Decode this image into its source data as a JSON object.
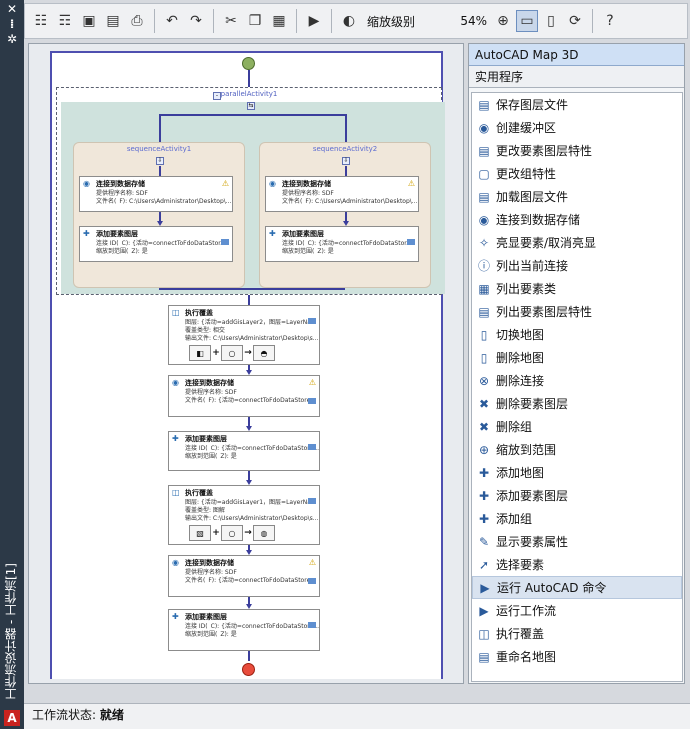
{
  "sidebar": {
    "close_glyph": "✕",
    "pin_glyph": "⁞",
    "gear_glyph": "✲",
    "title": "工作流设计器 - 工作流[1]"
  },
  "toolbar": {
    "zoom_label": "缩放级别",
    "zoom_value": "54%"
  },
  "workflow": {
    "parallel_label": "parallelActivity1",
    "sequences": [
      {
        "label": "sequenceActivity1",
        "activities": [
          {
            "title": "连接到数据存储",
            "lines": [
              "提供程序名称: SDF",
              "文件名(_F): C:\\Users\\Administrator\\Desktop\\..."
            ]
          },
          {
            "title": "添加要素图层",
            "lines": [
              "连接 ID(_C): {活动=connectToFdoDataStor...",
              "缩放到范围(_Z): 是"
            ]
          }
        ]
      },
      {
        "label": "sequenceActivity2",
        "activities": [
          {
            "title": "连接到数据存储",
            "lines": [
              "提供程序名称: SDF",
              "文件名(_F): C:\\Users\\Administrator\\Desktop\\..."
            ]
          },
          {
            "title": "添加要素图层",
            "lines": [
              "连接 ID(_C): {活动=connectToFdoDataStor...",
              "缩放到范围(_Z): 是"
            ]
          }
        ]
      }
    ],
    "main": [
      {
        "title": "执行覆盖",
        "lines": [
          "图层: {活动=addGisLayer2，图层=LayerNa...",
          "覆盖类型: 相交",
          "输出文件: C:\\Users\\Administrator\\Desktop\\s..."
        ],
        "overlay": true
      },
      {
        "title": "连接到数据存储",
        "lines": [
          "提供程序名称: SDF",
          "文件名(_F): {活动=connectToFdoDataStore..."
        ]
      },
      {
        "title": "添加要素图层",
        "lines": [
          "连接 ID(_C): {活动=connectToFdoDataStore...",
          "缩放到范围(_Z): 是"
        ]
      },
      {
        "title": "执行覆盖",
        "lines": [
          "图层: {活动=addGisLayer1，图层=LayerNa...",
          "覆盖类型: 图解",
          "输出文件: C:\\Users\\Administrator\\Desktop\\s..."
        ],
        "overlay": true
      },
      {
        "title": "连接到数据存储",
        "lines": [
          "提供程序名称: SDF",
          "文件名(_F): {活动=connectToFdoDataStore..."
        ]
      },
      {
        "title": "添加要素图层",
        "lines": [
          "连接 ID(_C): {活动=connectToFdoDataStore...",
          "缩放到范围(_Z): 是"
        ]
      }
    ]
  },
  "right_panel": {
    "header": "AutoCAD Map 3D",
    "subheader": "实用程序",
    "items": [
      {
        "label": "保存图层文件",
        "icon": "save-layer-icon"
      },
      {
        "label": "创建缓冲区",
        "icon": "buffer-icon"
      },
      {
        "label": "更改要素图层特性",
        "icon": "layer-props-icon"
      },
      {
        "label": "更改组特性",
        "icon": "group-props-icon"
      },
      {
        "label": "加载图层文件",
        "icon": "load-layer-icon"
      },
      {
        "label": "连接到数据存储",
        "icon": "connect-icon"
      },
      {
        "label": "亮显要素/取消亮显",
        "icon": "highlight-icon"
      },
      {
        "label": "列出当前连接",
        "icon": "list-connections-icon"
      },
      {
        "label": "列出要素类",
        "icon": "list-classes-icon"
      },
      {
        "label": "列出要素图层特性",
        "icon": "list-layer-props-icon"
      },
      {
        "label": "切换地图",
        "icon": "switch-map-icon"
      },
      {
        "label": "删除地图",
        "icon": "delete-map-icon"
      },
      {
        "label": "删除连接",
        "icon": "delete-connection-icon"
      },
      {
        "label": "删除要素图层",
        "icon": "delete-layer-icon"
      },
      {
        "label": "删除组",
        "icon": "delete-group-icon"
      },
      {
        "label": "缩放到范围",
        "icon": "zoom-extents-icon"
      },
      {
        "label": "添加地图",
        "icon": "add-map-icon"
      },
      {
        "label": "添加要素图层",
        "icon": "add-layer-icon"
      },
      {
        "label": "添加组",
        "icon": "add-group-icon"
      },
      {
        "label": "显示要素属性",
        "icon": "show-attributes-icon"
      },
      {
        "label": "选择要素",
        "icon": "select-icon"
      },
      {
        "label": "运行 AutoCAD 命令",
        "icon": "run-command-icon",
        "selected": true
      },
      {
        "label": "运行工作流",
        "icon": "run-workflow-icon"
      },
      {
        "label": "执行覆盖",
        "icon": "overlay-icon"
      },
      {
        "label": "重命名地图",
        "icon": "rename-map-icon"
      }
    ]
  },
  "status": {
    "label": "工作流状态:",
    "value": "就绪"
  }
}
